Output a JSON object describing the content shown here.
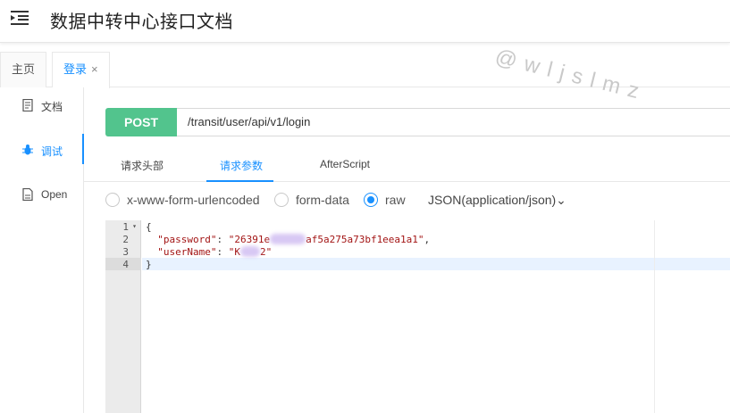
{
  "header": {
    "title": "数据中转中心接口文档",
    "menu_icon": "menu-fold-icon"
  },
  "tabs": [
    {
      "label": "主页",
      "active": false
    },
    {
      "label": "登录",
      "active": true,
      "close": "×"
    }
  ],
  "watermark": "@wljslmz",
  "sidebar": {
    "items": [
      {
        "label": "文档",
        "icon": "document-icon",
        "active": false
      },
      {
        "label": "调试",
        "icon": "bug-icon",
        "active": true
      },
      {
        "label": "Open",
        "icon": "file-icon",
        "active": false
      }
    ]
  },
  "request": {
    "method": "POST",
    "url": "/transit/user/api/v1/login",
    "method_color": "#52c48d"
  },
  "subtabs": [
    {
      "label": "请求头部",
      "active": false
    },
    {
      "label": "请求参数",
      "active": true
    },
    {
      "label": "AfterScript",
      "active": false
    }
  ],
  "body_types": {
    "options": [
      {
        "label": "x-www-form-urlencoded",
        "checked": false
      },
      {
        "label": "form-data",
        "checked": false
      },
      {
        "label": "raw",
        "checked": true
      }
    ],
    "content_type": "JSON(application/json)",
    "content_type_caret": "⌄"
  },
  "editor": {
    "line_numbers": [
      "1",
      "2",
      "3",
      "4"
    ],
    "lines": {
      "l1": "{",
      "l2_key": "\"password\"",
      "l2_sep": ": ",
      "l2_val_start": "\"26391e",
      "l2_val_end": "af5a275a73bf1eea1a1\"",
      "l2_comma": ",",
      "l3_key": "\"userName\"",
      "l3_sep": ": ",
      "l3_val_start": "\"K",
      "l3_val_end": "2\"",
      "l4": "}"
    }
  },
  "colors": {
    "accent": "#1890ff",
    "post": "#52c48d"
  }
}
